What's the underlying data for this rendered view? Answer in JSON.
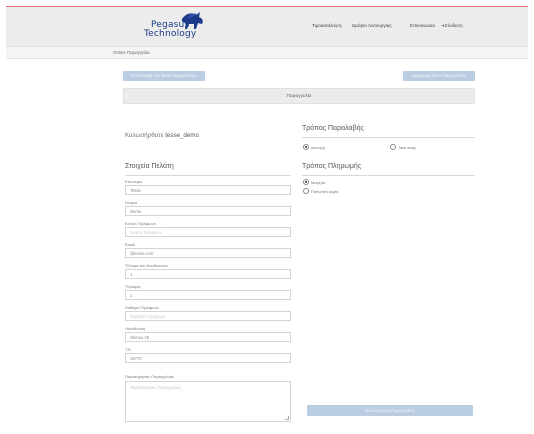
{
  "header": {
    "logo_line1": "Pegasus",
    "logo_line2": "Technology",
    "nav": [
      "Τιμοκαταλογος",
      "Ωράριο Λειτουργίας",
      "Επικοινωνία",
      "Σύνδεση"
    ]
  },
  "breadcrumb": "Online Παραγγελία",
  "actions": {
    "left_button": "Επιστροφή στη λίστα Παραγγελιών",
    "right_button": "Εφαρμογή όλων Παραγγελίας"
  },
  "order_title": "Παραγγελία",
  "customer": {
    "label": "Καλωσήρθατε",
    "username": "tesse_demo"
  },
  "sections": {
    "customer_info": "Στοιχεία Πελάτη",
    "delivery": "Τρόπος Παραλαβής",
    "payment": "Τρόπος Πληρωμής"
  },
  "fields": [
    {
      "label": "Επώνυμο",
      "value": "Tesse",
      "placeholder": ""
    },
    {
      "label": "Όνομα",
      "value": "Demo",
      "placeholder": ""
    },
    {
      "label": "Κινητό Τηλέφωνο",
      "value": "",
      "placeholder": "Κινητό Τηλέφωνο"
    },
    {
      "label": "Email",
      "value": "@tesse.com",
      "placeholder": ""
    },
    {
      "label": "*Όνομα του Κουδουνιού",
      "value": "1",
      "placeholder": ""
    },
    {
      "label": "*Όροφος",
      "value": "1",
      "placeholder": ""
    },
    {
      "label": "Σταθερό Τηλέφωνο",
      "value": "",
      "placeholder": "Σταθερό Τηλέφωνο"
    },
    {
      "label": "*Διεύθυνση",
      "value": "Olimou 26",
      "placeholder": ""
    },
    {
      "label": "Τ.Κ.",
      "value": "15772",
      "placeholder": ""
    }
  ],
  "comments": {
    "label": "Παρατηρήσεις Παραγγελίας",
    "placeholder": "Παρατηρήσεις Παραγγελίας"
  },
  "delivery_options": [
    {
      "label": "Διανομή",
      "selected": true
    },
    {
      "label": "Take away",
      "selected": false
    }
  ],
  "payment_options": [
    {
      "label": "Μετρητά",
      "selected": true
    },
    {
      "label": "Πιστωτική κάρτα",
      "selected": false
    }
  ],
  "submit_button": "Ολοκλήρωση Παραγγελίας",
  "colors": {
    "accent_button": "#b9cce2",
    "header_bg": "#ececec",
    "logo_blue": "#1b3a8a",
    "frame_red": "#e07070"
  }
}
